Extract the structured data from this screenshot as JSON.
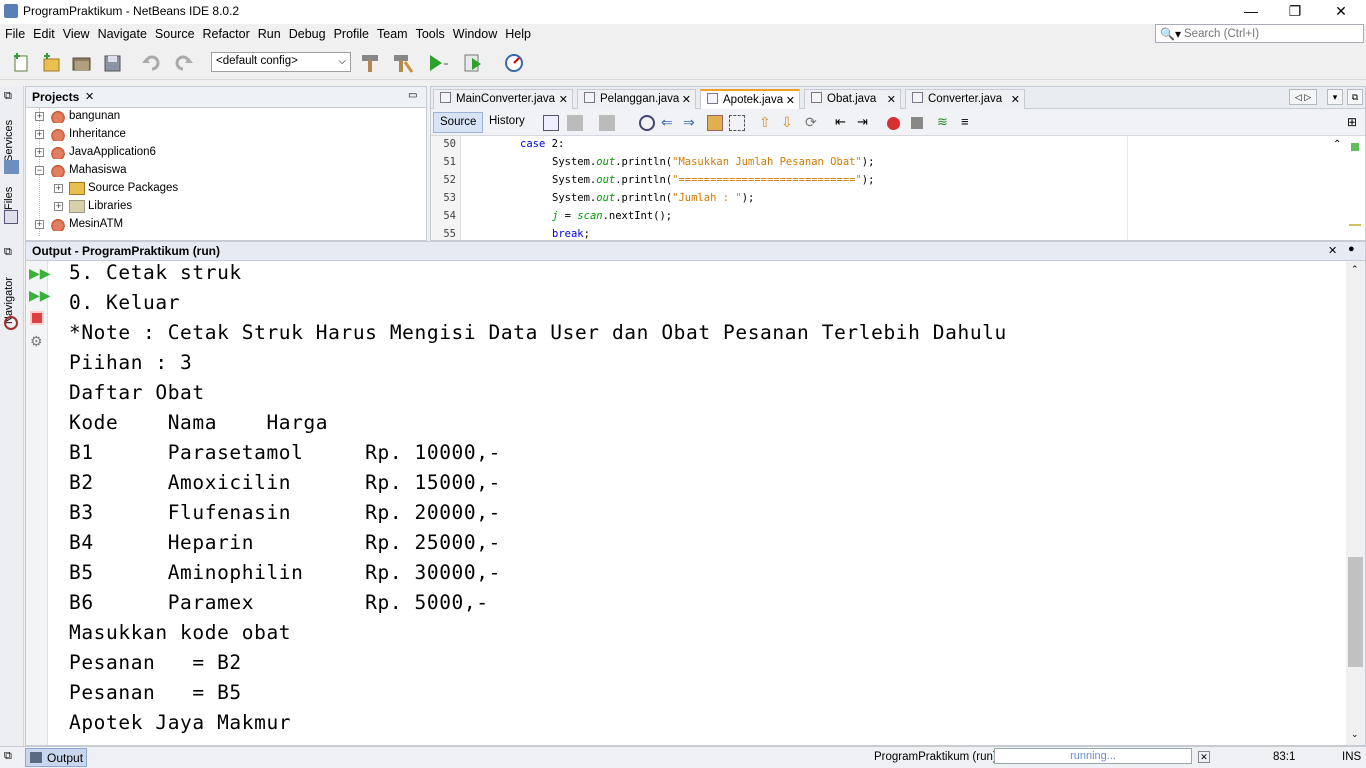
{
  "window": {
    "title": "ProgramPraktikum - NetBeans IDE 8.0.2",
    "minimize": "—",
    "restore": "❐",
    "close": "✕"
  },
  "menu": [
    "File",
    "Edit",
    "View",
    "Navigate",
    "Source",
    "Refactor",
    "Run",
    "Debug",
    "Profile",
    "Team",
    "Tools",
    "Window",
    "Help"
  ],
  "search": {
    "placeholder": "Search (Ctrl+I)"
  },
  "toolbar": {
    "config": "<default config>"
  },
  "side_tabs": {
    "services": "Services",
    "files": "Files",
    "navigator": "Navigator"
  },
  "projects": {
    "title": "Projects",
    "items": [
      {
        "label": "bangunan",
        "level": 0,
        "expanded": false
      },
      {
        "label": "Inheritance",
        "level": 0,
        "expanded": false
      },
      {
        "label": "JavaApplication6",
        "level": 0,
        "expanded": false
      },
      {
        "label": "Mahasiswa",
        "level": 0,
        "expanded": true
      },
      {
        "label": "Source Packages",
        "level": 1,
        "expanded": false
      },
      {
        "label": "Libraries",
        "level": 1,
        "expanded": false
      },
      {
        "label": "MesinATM",
        "level": 0,
        "expanded": false
      }
    ]
  },
  "editor": {
    "tabs": [
      {
        "label": "MainConverter.java",
        "active": false
      },
      {
        "label": "Pelanggan.java",
        "active": false
      },
      {
        "label": "Apotek.java",
        "active": true
      },
      {
        "label": "Obat.java",
        "active": false
      },
      {
        "label": "Converter.java",
        "active": false
      }
    ],
    "source_tab": "Source",
    "history_tab": "History",
    "line_numbers": [
      "50",
      "51",
      "52",
      "53",
      "54",
      "55"
    ],
    "code": [
      {
        "kw": "case",
        "rest": " 2:"
      },
      {
        "pre": "System.",
        "fld": "out",
        "mid": ".println(",
        "str": "\"Masukkan Jumlah Pesanan Obat\"",
        "post": ");"
      },
      {
        "pre": "System.",
        "fld": "out",
        "mid": ".println(",
        "str": "\"============================\"",
        "post": ");"
      },
      {
        "pre": "System.",
        "fld": "out",
        "mid": ".println(",
        "str": "\"Jumlah : \"",
        "post": ");"
      },
      {
        "pre": "",
        "fld": "j",
        "mid": " = ",
        "str": "",
        "post": "",
        "scan": "scan",
        "tail": ".nextInt();"
      },
      {
        "kw": "break",
        "rest": ";"
      }
    ]
  },
  "output": {
    "title": "Output - ProgramPraktikum (run)",
    "lines": [
      "5. Cetak struk",
      "0. Keluar",
      "*Note : Cetak Struk Harus Mengisi Data User dan Obat Pesanan Terlebih Dahulu",
      "Piihan : 3",
      "Daftar Obat",
      "Kode    Nama    Harga",
      "B1      Parasetamol     Rp. 10000,-",
      "B2      Amoxicilin      Rp. 15000,-",
      "B3      Flufenasin      Rp. 20000,-",
      "B4      Heparin         Rp. 25000,-",
      "B5      Aminophilin     Rp. 30000,-",
      "B6      Paramex         Rp. 5000,-",
      "Masukkan kode obat",
      "Pesanan   = B2",
      "Pesanan   = B5",
      "Apotek Jaya Makmur"
    ]
  },
  "status": {
    "output_tab": "Output",
    "process": "ProgramPraktikum (run)",
    "progress_text": "running...",
    "position": "83:1",
    "mode": "INS"
  },
  "colors": {
    "keyword": "#0000e6",
    "string": "#ce7b00",
    "field": "#009900",
    "accent_tab": "#f0a030"
  }
}
